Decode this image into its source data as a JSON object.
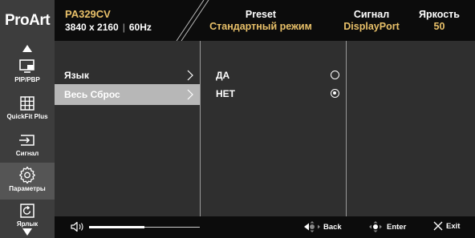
{
  "header": {
    "brand": "ProArt",
    "model": "PA329CV",
    "resolution": "3840 x 2160",
    "refresh": "60Hz",
    "preset_label": "Preset",
    "preset_value": "Стандартный режим",
    "signal_label": "Сигнал",
    "signal_value": "DisplayPort",
    "brightness_label": "Яркость",
    "brightness_value": "50"
  },
  "sidebar": {
    "items": [
      {
        "label": "PIP/PBP",
        "icon": "pip-pbp-icon"
      },
      {
        "label": "QuickFit Plus",
        "icon": "quickfit-grid-icon"
      },
      {
        "label": "Сигнал",
        "icon": "input-signal-icon"
      },
      {
        "label": "Параметры",
        "icon": "gear-icon"
      },
      {
        "label": "Ярлык",
        "icon": "shortcut-icon"
      }
    ],
    "active_index": 3
  },
  "menu": {
    "items": [
      "Язык",
      "Весь Сброс"
    ],
    "selected_index": 1
  },
  "options": {
    "items": [
      "ДА",
      "НЕТ"
    ],
    "checked_index": 1
  },
  "footer": {
    "volume_level_fraction": 0.5,
    "back_label": "Back",
    "enter_label": "Enter",
    "exit_label": "Exit"
  },
  "colors": {
    "accent": "#e8c069",
    "selected_row": "#b7b7b7",
    "panel": "#2f2f2f",
    "header": "#0c0c0c",
    "sidebar": "#3d3d3d"
  }
}
